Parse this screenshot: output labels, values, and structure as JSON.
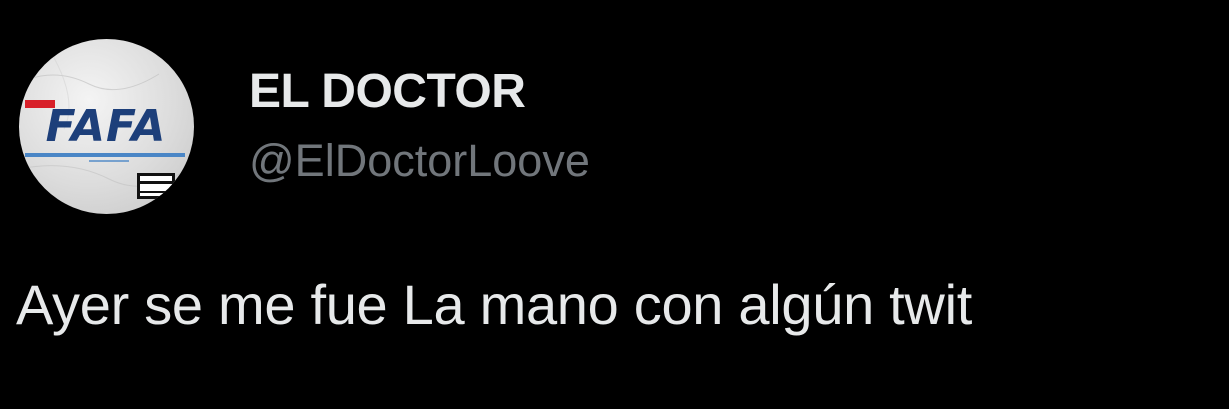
{
  "tweet": {
    "author": {
      "display_name": "EL DOCTOR",
      "handle": "@ElDoctorLoove",
      "avatar": {
        "logo_text": "FAFA",
        "icon": "avatar-image"
      }
    },
    "text": "Ayer se me fue La mano con algún twit"
  },
  "colors": {
    "background": "#000000",
    "primary_text": "#e7e9ea",
    "secondary_text": "#71767b",
    "logo_navy": "#1d3f7a",
    "logo_red": "#d8202a",
    "logo_blue_line": "#4a86c6"
  }
}
